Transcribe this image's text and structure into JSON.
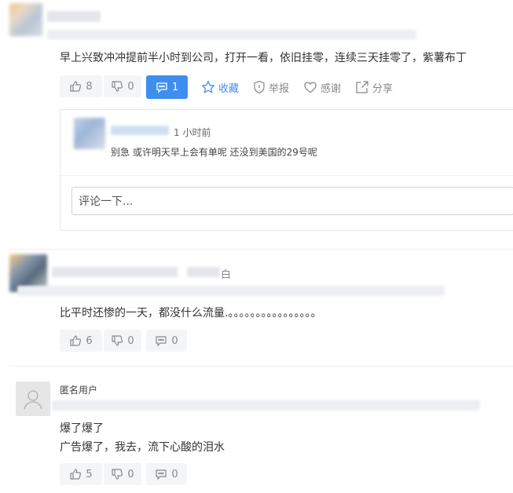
{
  "comments": [
    {
      "text": "早上兴致冲冲提前半小时到公司，打开一看，依旧挂零，连续三天挂零了，紫薯布丁",
      "likes": "8",
      "dislikes": "0",
      "replies": "1",
      "actions": {
        "favorite": "收藏",
        "report": "举报",
        "thanks": "感谢",
        "share": "分享"
      },
      "reply": {
        "time": "1 小时前",
        "text": "别急 或许明天早上会有单呢 还没到美国的29号呢"
      },
      "reply_input_placeholder": "评论一下..."
    },
    {
      "name_suffix": "白",
      "text": "比平时还惨的一天，都没什么流量.。。。。。。。。。。。。。。。。",
      "likes": "6",
      "dislikes": "0",
      "replies": "0"
    },
    {
      "author": "匿名用户",
      "lines": [
        "爆了爆了",
        "广告爆了，我去，流下心酸的泪水"
      ],
      "likes": "5",
      "dislikes": "0",
      "replies": "0"
    }
  ],
  "icons": {
    "like": "thumbs-up-icon",
    "dislike": "thumbs-down-icon",
    "comment": "comment-bubble-icon",
    "favorite": "star-icon",
    "report": "shield-icon",
    "thanks": "heart-icon",
    "share": "share-icon",
    "user": "user-silhouette-icon"
  },
  "colors": {
    "accent": "#3e8ef0",
    "muted": "#888888"
  }
}
